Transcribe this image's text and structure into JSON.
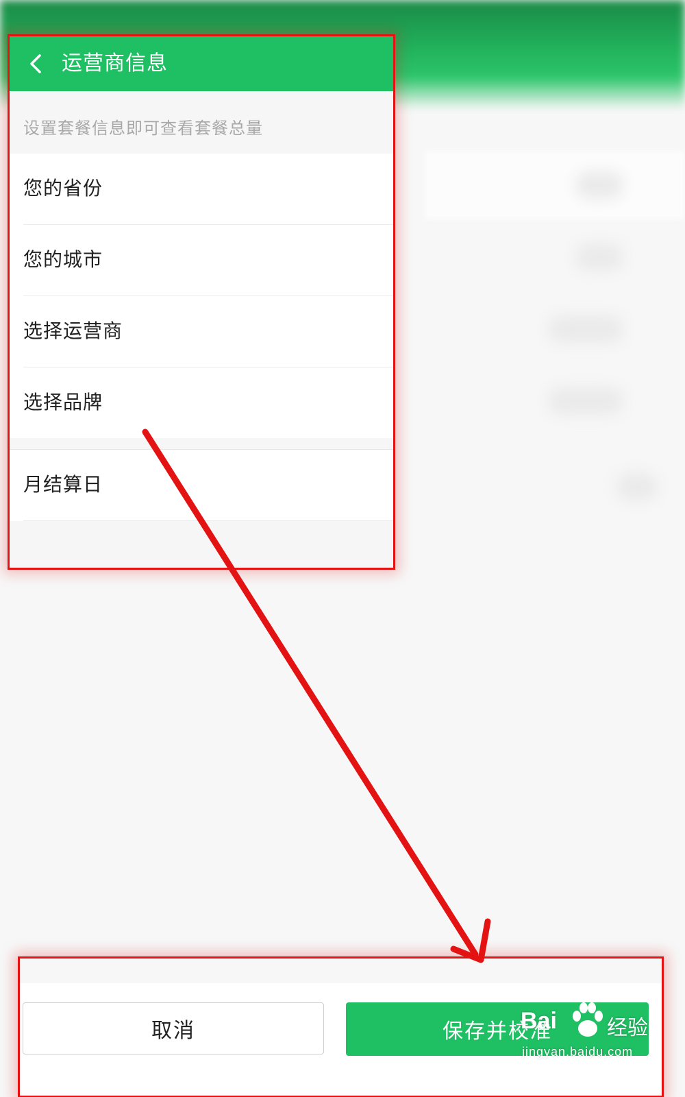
{
  "header": {
    "title": "运营商信息",
    "back_icon": "chevron-left-icon"
  },
  "hint_text": "设置套餐信息即可查看套餐总量",
  "settings_items": [
    {
      "label": "您的省份"
    },
    {
      "label": "您的城市"
    },
    {
      "label": "选择运营商"
    },
    {
      "label": "选择品牌"
    }
  ],
  "billing_item": {
    "label": "月结算日"
  },
  "actions": {
    "cancel_label": "取消",
    "save_label": "保存并校准"
  },
  "watermark": {
    "brand": "Bai",
    "brand_cn": "经验",
    "url": "jingyan.baidu.com"
  },
  "colors": {
    "accent_green": "#1fbf63",
    "annotation_red": "#e31313",
    "hint_gray": "#a8a8a8"
  }
}
